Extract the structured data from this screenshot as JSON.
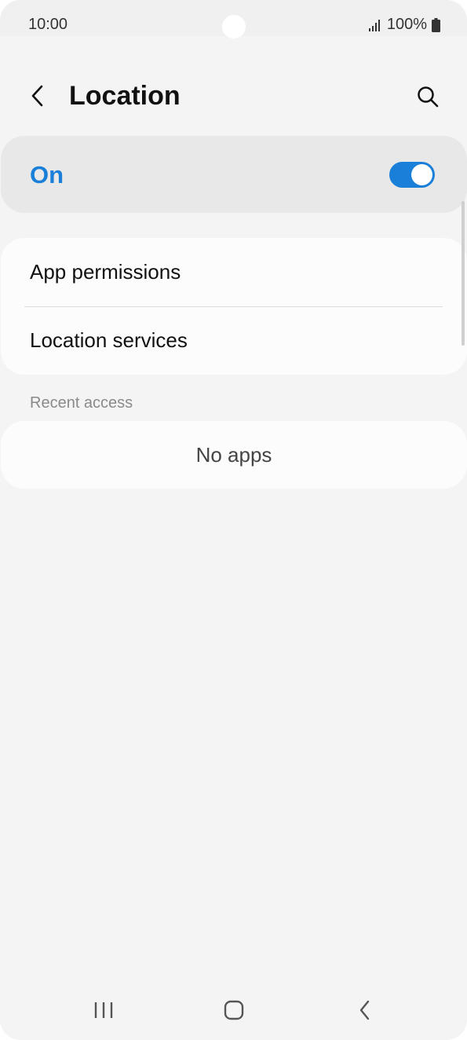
{
  "status_bar": {
    "time": "10:00",
    "battery": "100%",
    "icons": [
      "signal-icon",
      "battery-icon"
    ]
  },
  "header": {
    "title": "Location",
    "back_icon": "chevron-left-icon",
    "search_icon": "search-icon"
  },
  "master_switch": {
    "label": "On",
    "state": "on",
    "accent_color": "#1a7fd9"
  },
  "menu": {
    "items": [
      {
        "label": "App permissions"
      },
      {
        "label": "Location services"
      }
    ]
  },
  "recent_access": {
    "header": "Recent access",
    "empty_text": "No apps"
  },
  "nav_bar": {
    "icons": [
      "recents-icon",
      "home-icon",
      "back-icon"
    ]
  }
}
